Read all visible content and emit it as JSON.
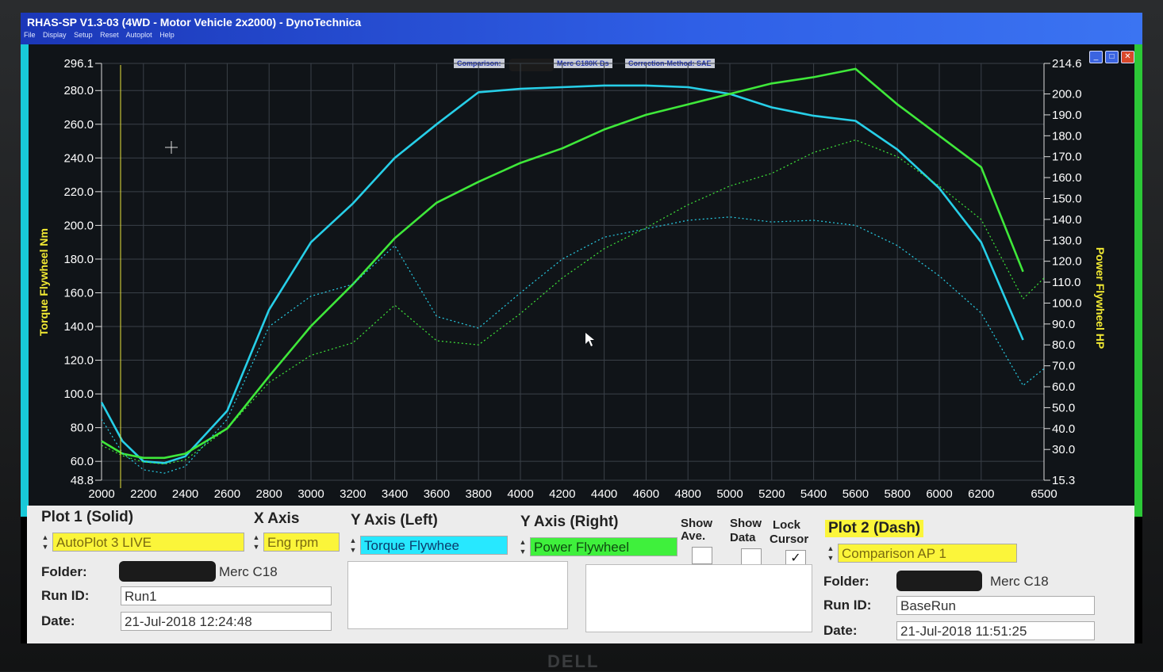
{
  "window": {
    "title": "RHAS-SP V1.3-03  (4WD - Motor Vehicle 2x2000) - DynoTechnica",
    "menu": [
      "File",
      "Display",
      "Setup",
      "Reset",
      "Autoplot",
      "Help"
    ],
    "buttons": {
      "minimize": "_",
      "maximize": "□",
      "close": "✕"
    }
  },
  "header": {
    "comparison_label": "Comparison:",
    "comparison_name": "Merc C180K Ds",
    "correction_label": "Correction-Method: SAE"
  },
  "colors": {
    "torque": "#27cfe8",
    "power": "#3fe83a",
    "panel": "#ececec",
    "accent_yellow": "#fbf53a"
  },
  "chart_data": {
    "type": "line",
    "xlabel": "",
    "ylabel": "Torque Flywheel Nm",
    "y2label": "Power Flywheel HP",
    "x_ticks": [
      2000,
      2200,
      2400,
      2600,
      2800,
      3000,
      3200,
      3400,
      3600,
      3800,
      4000,
      4200,
      4400,
      4600,
      4800,
      5000,
      5200,
      5400,
      5600,
      5800,
      6000,
      6200,
      6500
    ],
    "y_ticks": [
      "296.1",
      "280.0",
      "260.0",
      "240.0",
      "220.0",
      "200.0",
      "180.0",
      "160.0",
      "140.0",
      "120.0",
      "100.0",
      "80.0",
      "60.0",
      "48.8"
    ],
    "y2_ticks": [
      "214.6",
      "200.0",
      "190.0",
      "180.0",
      "170.0",
      "160.0",
      "150.0",
      "140.0",
      "130.0",
      "120.0",
      "110.0",
      "100.0",
      "90.0",
      "80.0",
      "70.0",
      "60.0",
      "50.0",
      "40.0",
      "30.0",
      "15.3"
    ],
    "xlim": [
      2000,
      6500
    ],
    "ylim": [
      48.8,
      296.1
    ],
    "y2lim": [
      15.3,
      214.6
    ],
    "grid": true,
    "series": [
      {
        "name": "Torque Flywheel",
        "axis": "left",
        "style": "solid",
        "color": "#27cfe8",
        "x": [
          2000,
          2100,
          2200,
          2300,
          2400,
          2600,
          2800,
          3000,
          3200,
          3400,
          3600,
          3800,
          4000,
          4200,
          4400,
          4600,
          4800,
          5000,
          5200,
          5400,
          5600,
          5800,
          6000,
          6200,
          6400
        ],
        "y": [
          95,
          72,
          60,
          59,
          63,
          90,
          150,
          190,
          213,
          240,
          260,
          279,
          281,
          282,
          283,
          283,
          282,
          278,
          270,
          265,
          262,
          245,
          222,
          190,
          132
        ]
      },
      {
        "name": "Power Flywheel",
        "axis": "right",
        "style": "solid",
        "color": "#3fe83a",
        "x": [
          2000,
          2100,
          2200,
          2300,
          2400,
          2600,
          2800,
          3000,
          3200,
          3400,
          3600,
          3800,
          4000,
          4200,
          4400,
          4600,
          4800,
          5000,
          5200,
          5400,
          5600,
          5800,
          6000,
          6200,
          6400
        ],
        "y": [
          34,
          28,
          26,
          26,
          28,
          40,
          65,
          89,
          109,
          131,
          148,
          158,
          167,
          174,
          183,
          190,
          195,
          200,
          205,
          208,
          212,
          195,
          180,
          165,
          115
        ]
      },
      {
        "name": "Comparison Torque",
        "axis": "left",
        "style": "dash",
        "color": "#27cfe8",
        "x": [
          2000,
          2100,
          2200,
          2300,
          2400,
          2600,
          2800,
          3000,
          3200,
          3400,
          3600,
          3800,
          4000,
          4200,
          4400,
          4600,
          4800,
          5000,
          5200,
          5400,
          5600,
          5800,
          6000,
          6200,
          6400,
          6500
        ],
        "y": [
          85,
          65,
          55,
          53,
          57,
          85,
          140,
          158,
          165,
          188,
          146,
          139,
          160,
          180,
          193,
          198,
          203,
          205,
          202,
          203,
          200,
          188,
          170,
          148,
          105,
          115
        ]
      },
      {
        "name": "Comparison Power",
        "axis": "right",
        "style": "dash",
        "color": "#3fe83a",
        "x": [
          2000,
          2100,
          2200,
          2300,
          2400,
          2600,
          2800,
          3000,
          3200,
          3400,
          3600,
          3800,
          4000,
          4200,
          4400,
          4600,
          4800,
          5000,
          5200,
          5400,
          5600,
          5800,
          6000,
          6200,
          6400,
          6500
        ],
        "y": [
          32,
          27,
          24,
          23,
          25,
          40,
          62,
          75,
          81,
          99,
          82,
          80,
          95,
          112,
          126,
          136,
          147,
          156,
          162,
          172,
          178,
          170,
          156,
          140,
          102,
          112
        ]
      }
    ]
  },
  "panel": {
    "plot1": {
      "title": "Plot 1 (Solid)",
      "value": "AutoPlot 3 LIVE"
    },
    "x_axis": {
      "title": "X Axis",
      "value": "Eng rpm"
    },
    "y_axis_left": {
      "title": "Y Axis (Left)",
      "value": "Torque Flywhee"
    },
    "y_axis_right": {
      "title": "Y Axis (Right)",
      "value": "Power Flywheel"
    },
    "show_ave": {
      "label1": "Show",
      "label2": "Ave.",
      "checked": false
    },
    "show_data": {
      "label1": "Show",
      "label2": "Data",
      "checked": false
    },
    "lock_cursor": {
      "label1": "Lock",
      "label2": "Cursor",
      "checked": true,
      "mark": "✓"
    },
    "plot2": {
      "title": "Plot 2 (Dash)",
      "value": "Comparison AP 1"
    },
    "left_info": {
      "folder_label": "Folder:",
      "folder_value": "Merc C18",
      "run_label": "Run ID:",
      "run_value": "Run1",
      "date_label": "Date:",
      "date_value": "21-Jul-2018  12:24:48"
    },
    "right_info": {
      "folder_label": "Folder:",
      "folder_value": "Merc C18",
      "run_label": "Run ID:",
      "run_value": "BaseRun",
      "date_label": "Date:",
      "date_value": "21-Jul-2018  11:51:25"
    }
  },
  "monitor": {
    "brand": "DELL"
  }
}
